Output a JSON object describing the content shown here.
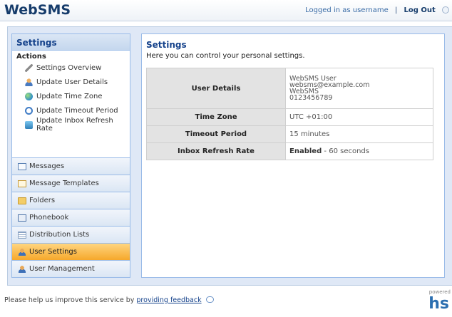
{
  "header": {
    "logo": "WebSMS",
    "logged_in_text": "Logged in as  username",
    "separator": "|",
    "logout": "Log Out"
  },
  "sidebar": {
    "title": "Settings",
    "actions_label": "Actions",
    "actions": [
      {
        "label": "Settings Overview",
        "icon": "wrench-icon"
      },
      {
        "label": "Update User Details",
        "icon": "user-icon"
      },
      {
        "label": "Update Time Zone",
        "icon": "globe-icon"
      },
      {
        "label": "Update Timeout Period",
        "icon": "clock-icon"
      },
      {
        "label": "Update Inbox Refresh Rate",
        "icon": "refresh-icon"
      }
    ],
    "nav": [
      {
        "label": "Messages",
        "icon": "mail-icon"
      },
      {
        "label": "Message Templates",
        "icon": "template-icon"
      },
      {
        "label": "Folders",
        "icon": "folder-icon"
      },
      {
        "label": "Phonebook",
        "icon": "phonebook-icon"
      },
      {
        "label": "Distribution Lists",
        "icon": "list-icon"
      },
      {
        "label": "User Settings",
        "icon": "user-settings-icon",
        "active": true
      },
      {
        "label": "User Management",
        "icon": "user-management-icon"
      }
    ]
  },
  "main": {
    "title": "Settings",
    "description": "Here you can control your personal settings.",
    "rows": {
      "user_details": {
        "label": "User Details",
        "name": "WebSMS User",
        "email": "websms@example.com",
        "company": "WebSMS",
        "phone": "0123456789"
      },
      "time_zone": {
        "label": "Time Zone",
        "value": "UTC +01:00"
      },
      "timeout": {
        "label": "Timeout Period",
        "value": "15 minutes"
      },
      "inbox_refresh": {
        "label": "Inbox Refresh Rate",
        "status": "Enabled",
        "value": "- 60 seconds"
      }
    }
  },
  "footer": {
    "text": "Please help us improve this service by",
    "link": "providing feedback",
    "powered": "powered",
    "brand": "hs"
  },
  "colors": {
    "brand_blue": "#15428b",
    "active_nav": "#f6a82b",
    "panel_border": "#99bbe8"
  }
}
